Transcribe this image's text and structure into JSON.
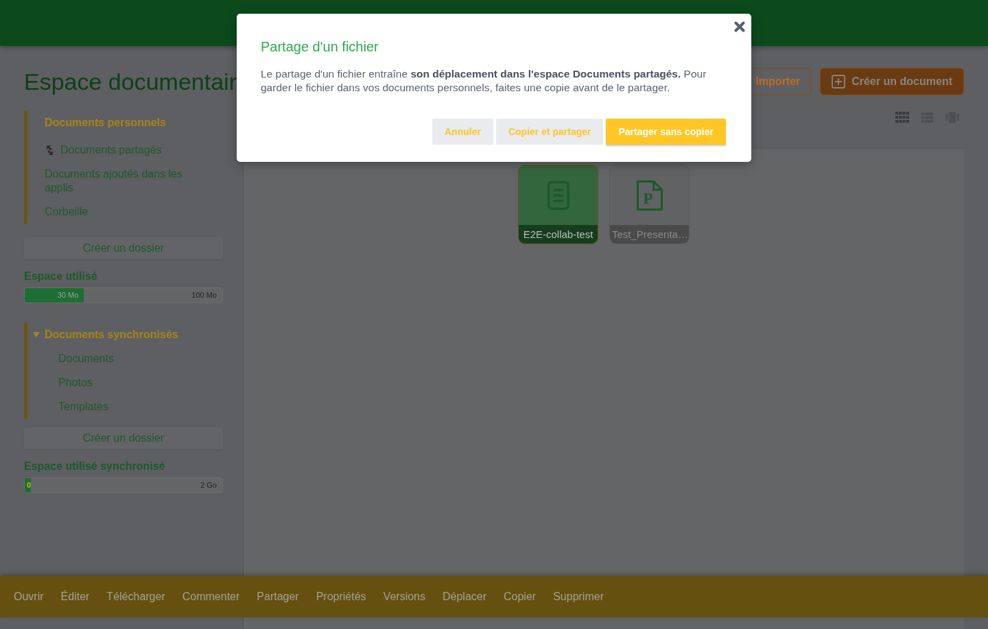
{
  "page_title": "Espace documentair",
  "header_actions": [
    {
      "label": "Importer",
      "kind": "upload"
    },
    {
      "label": "Créer un document",
      "kind": "create"
    }
  ],
  "sidebar": {
    "personal_items": [
      {
        "label": "Documents personnels",
        "kind": "plain",
        "selected": true
      },
      {
        "label": "Documents partagés",
        "kind": "shared",
        "selected": false
      },
      {
        "label": "Documents ajoutés dans les applis",
        "kind": "plain",
        "selected": false
      },
      {
        "label": "Corbeille",
        "kind": "plain",
        "selected": false
      }
    ],
    "personal_create_folder": "Créer un dossier",
    "personal_usage": {
      "title": "Espace utilisé",
      "level": 0.3,
      "used": "30 Mo",
      "total": "100 Mo"
    },
    "sync_section": {
      "title": "Documents synchronisés",
      "expanded": true,
      "children": [
        {
          "label": "Documents",
          "selected": false
        },
        {
          "label": "Photos",
          "selected": false
        },
        {
          "label": "Templates",
          "selected": false
        }
      ]
    },
    "sync_create_folder": "Créer un dossier",
    "sync_usage": {
      "title": "Espace utilisé synchronisé",
      "level": 0.03,
      "used": "0",
      "total": "2 Go"
    }
  },
  "view_modes": [
    {
      "kind": "grid",
      "selected": true
    },
    {
      "kind": "list",
      "selected": false
    },
    {
      "kind": "carousel",
      "selected": false
    }
  ],
  "files": [
    {
      "name": "E2E-collab-test",
      "kind": "document",
      "selected": true
    },
    {
      "name": "Test_Presenta…",
      "kind": "presentation",
      "type_letter": "P",
      "selected": false
    }
  ],
  "action_bar": [
    "Ouvrir",
    "Éditer",
    "Télécharger",
    "Commenter",
    "Partager",
    "Propriétés",
    "Versions",
    "Déplacer",
    "Copier",
    "Supprimer"
  ],
  "dialog": {
    "title": "Partage d'un fichier",
    "message": "Le partage d'un fichier entraîne **son déplacement dans l'espace Documents partagés.** Pour garder le fichier dans vos documents personnels, faites une copie avant de le partager.",
    "buttons": [
      {
        "label": "Annuler",
        "kind": "secondary"
      },
      {
        "label": "Copier et partager",
        "kind": "secondary"
      },
      {
        "label": "Partager sans copier",
        "kind": "primary"
      }
    ]
  }
}
